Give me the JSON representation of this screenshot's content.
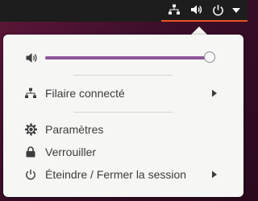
{
  "topbar": {
    "icons": [
      "network-wired-icon",
      "volume-icon",
      "power-icon",
      "dropdown-arrow-icon"
    ],
    "active_underline_color": "#e95420"
  },
  "menu": {
    "volume": {
      "icon": "volume-icon",
      "level_percent": 98,
      "fill_color": "#8e5699"
    },
    "network": {
      "icon": "network-wired-icon",
      "label": "Filaire connecté"
    },
    "settings": {
      "icon": "gear-icon",
      "label": "Paramètres"
    },
    "lock": {
      "icon": "lock-icon",
      "label": "Verrouiller"
    },
    "power": {
      "icon": "power-icon",
      "label": "Éteindre / Fermer la session"
    }
  }
}
